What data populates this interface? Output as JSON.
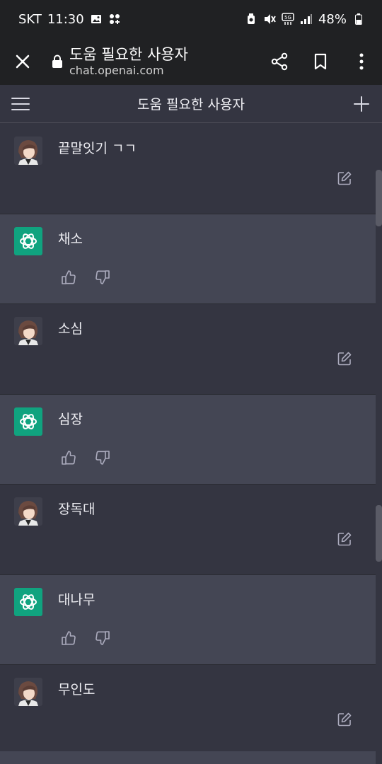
{
  "status_bar": {
    "carrier": "SKT",
    "time": "11:30",
    "battery": "48%",
    "icons": [
      "gallery-icon",
      "game-icon",
      "alarm-icon",
      "mute-icon",
      "5g-icon",
      "signal-icon",
      "battery-icon"
    ]
  },
  "browser": {
    "title": "도움 필요한 사용자",
    "url": "chat.openai.com",
    "icons": [
      "close-icon",
      "lock-icon",
      "share-icon",
      "bookmark-icon",
      "more-vert-icon"
    ]
  },
  "chat_header": {
    "title": "도움 필요한 사용자",
    "icons": [
      "menu-icon",
      "plus-icon"
    ]
  },
  "messages": [
    {
      "role": "user",
      "text": "끝말잇기 ㄱㄱ"
    },
    {
      "role": "assistant",
      "text": "채소"
    },
    {
      "role": "user",
      "text": "소심"
    },
    {
      "role": "assistant",
      "text": "심장"
    },
    {
      "role": "user",
      "text": "장독대"
    },
    {
      "role": "assistant",
      "text": "대나무"
    },
    {
      "role": "user",
      "text": "무인도"
    }
  ],
  "colors": {
    "bot_avatar": "#10a37f",
    "assistant_bg": "#444654",
    "user_bg": "#343541",
    "bar_bg": "#202123"
  }
}
